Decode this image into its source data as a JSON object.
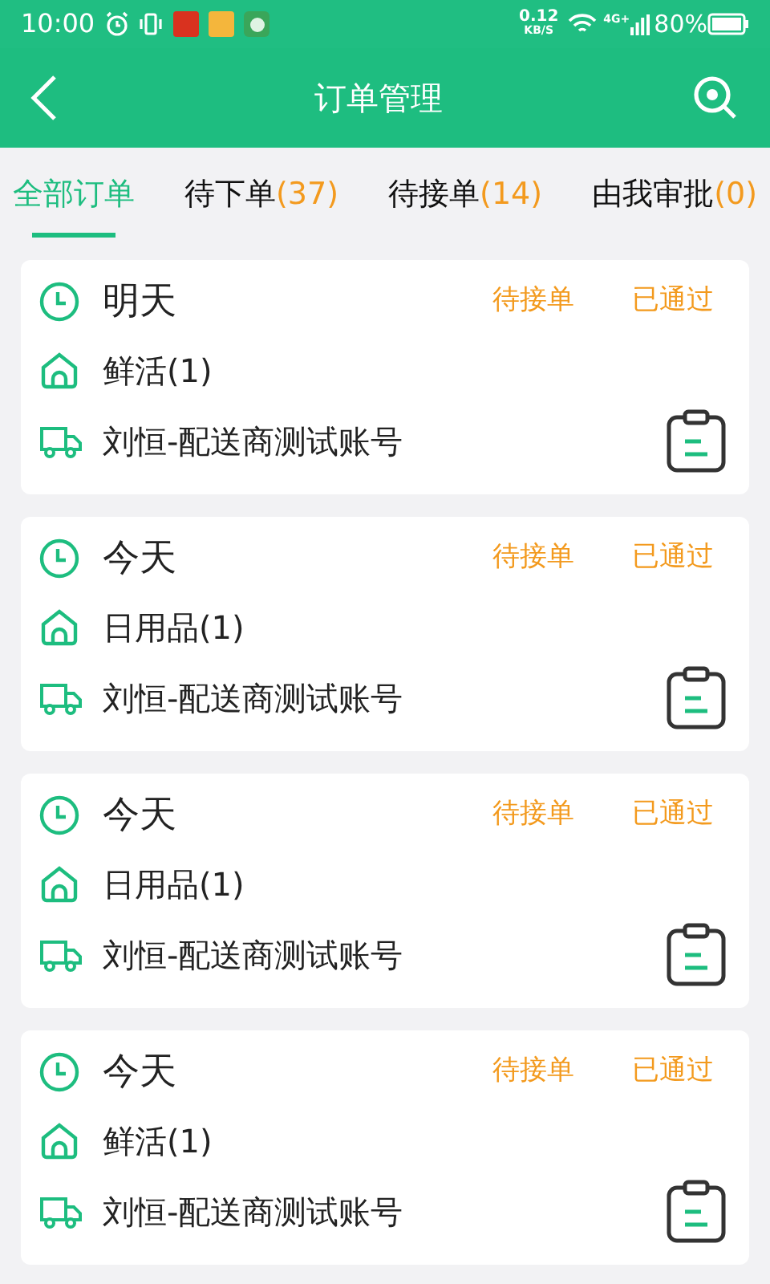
{
  "status_bar": {
    "time": "10:00",
    "speed": "0.12",
    "speed_unit": "KB/S",
    "network": "4G+",
    "battery": "80%"
  },
  "header": {
    "title": "订单管理"
  },
  "tabs": [
    {
      "label": "全部订单",
      "selected": true
    },
    {
      "label": "待下单",
      "count": "(37)",
      "selected": false
    },
    {
      "label": "待接单",
      "count": "(14)",
      "selected": false
    },
    {
      "label": "由我审批",
      "count": "(0)",
      "selected": false
    }
  ],
  "orders": [
    {
      "day": "明天",
      "status": "待接单",
      "approval": "已通过",
      "shop": "鲜活(1)",
      "carrier": "刘恒-配送商测试账号"
    },
    {
      "day": "今天",
      "status": "待接单",
      "approval": "已通过",
      "shop": "日用品(1)",
      "carrier": "刘恒-配送商测试账号"
    },
    {
      "day": "今天",
      "status": "待接单",
      "approval": "已通过",
      "shop": "日用品(1)",
      "carrier": "刘恒-配送商测试账号"
    },
    {
      "day": "今天",
      "status": "待接单",
      "approval": "已通过",
      "shop": "鲜活(1)",
      "carrier": "刘恒-配送商测试账号"
    }
  ]
}
